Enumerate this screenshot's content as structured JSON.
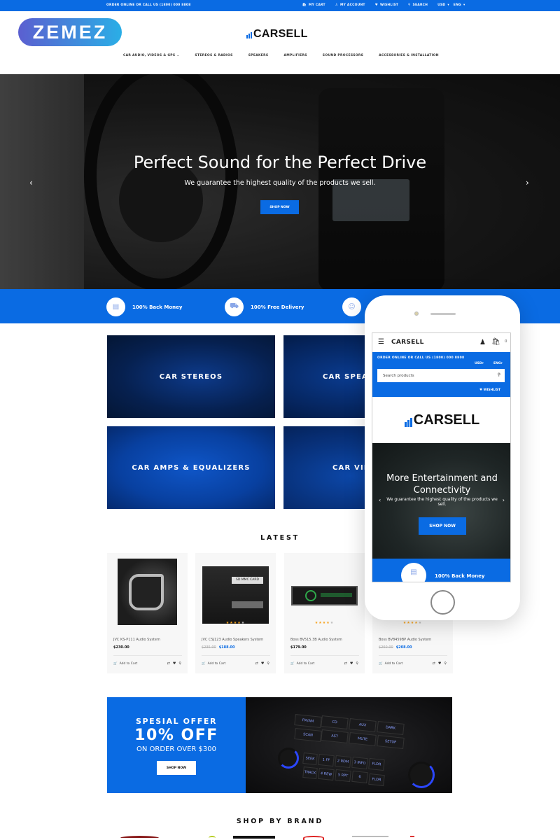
{
  "topbar": {
    "contact": "ORDER ONLINE OR CALL US (1800) 000 8808",
    "links": [
      {
        "icon": "bag-icon",
        "label": "MY CART"
      },
      {
        "icon": "user-icon",
        "label": "MY ACCOUNT"
      },
      {
        "icon": "heart-icon",
        "label": "WISHLIST"
      },
      {
        "icon": "search-icon",
        "label": "SEARCH"
      }
    ],
    "currency": "USD",
    "language": "ENG"
  },
  "badge": {
    "label": "ZEMEZ"
  },
  "header": {
    "logo": "CARSELL"
  },
  "nav": {
    "items": [
      "CAR AUDIO, VIDEOS & GPS",
      "STEREOS & RADIOS",
      "SPEAKERS",
      "AMPLIFIERS",
      "SOUND PROCESSORS",
      "ACCESSORIES & INSTALLATION"
    ]
  },
  "hero": {
    "title": "Perfect Sound for the Perfect Drive",
    "subtitle": "We guarantee the highest quality of the products we sell.",
    "button": "SHOP NOW",
    "prev": "‹",
    "next": "›"
  },
  "features": [
    {
      "icon": "wallet-icon",
      "label": "100% Back Money"
    },
    {
      "icon": "truck-icon",
      "label": "100% Free Delivery"
    },
    {
      "icon": "support-icon",
      "label": ""
    }
  ],
  "categories": [
    {
      "label": "CAR STEREOS"
    },
    {
      "label": "CAR SPEAK"
    },
    {
      "label": "CAR AMPS & EQUALIZERS"
    },
    {
      "label": "CAR VID"
    }
  ],
  "latest": {
    "title": "LATEST",
    "products": [
      {
        "name": "JVC KS-P111 Audio System",
        "price": "$230.00",
        "old_price": "",
        "rating": 0,
        "add": "Add to Cart"
      },
      {
        "name": "JVC CSJ123 Audio Speakers System",
        "price": "$188.00",
        "old_price": "$235.00",
        "rating": 4,
        "add": "Add to Cart"
      },
      {
        "name": "Boss BV515.3B Audio System",
        "price": "$179.00",
        "old_price": "",
        "rating": 4,
        "add": "Add to Cart"
      },
      {
        "name": "Boss BV8459BP Audio System",
        "price": "$208.00",
        "old_price": "$260.00",
        "rating": 4,
        "add": "Add to Cart"
      }
    ],
    "card_labels": {
      "sd_card": "SD MMC CARD"
    }
  },
  "offer": {
    "line1": "SPESIAL OFFER",
    "line2": "10% OFF",
    "line3": "ON ORDER OVER $300",
    "button": "SHOP NOW",
    "radio_buttons": [
      "FM/AM",
      "CD",
      "AUX",
      "DARK",
      "SCAN",
      "AST",
      "MUTE",
      "SETUP",
      "SEEK",
      "1 FF",
      "2 RDM",
      "3 INFO",
      "FLDR",
      "TRACK",
      "4 REW",
      "5 RPT",
      "6",
      "FLDR"
    ]
  },
  "brands": {
    "title": "SHOP BY BRAND"
  },
  "phone": {
    "brand": "CARSELL",
    "cart_count": "0",
    "contact": "ORDER ONLINE OR CALL US (1800) 000 8808",
    "currency": "USD",
    "language": "ENG",
    "search_placeholder": "Search products",
    "wishlist": "WISHLIST",
    "logo": "CARSELL",
    "hero_title": "More Entertainment and Connectivity",
    "hero_subtitle": "We guarantee the highest quality of the products we sell.",
    "hero_button": "SHOP NOW",
    "feature": "100% Back Money"
  },
  "colors": {
    "accent": "#0a6be3",
    "star": "#f7a21b",
    "text": "#111111"
  }
}
